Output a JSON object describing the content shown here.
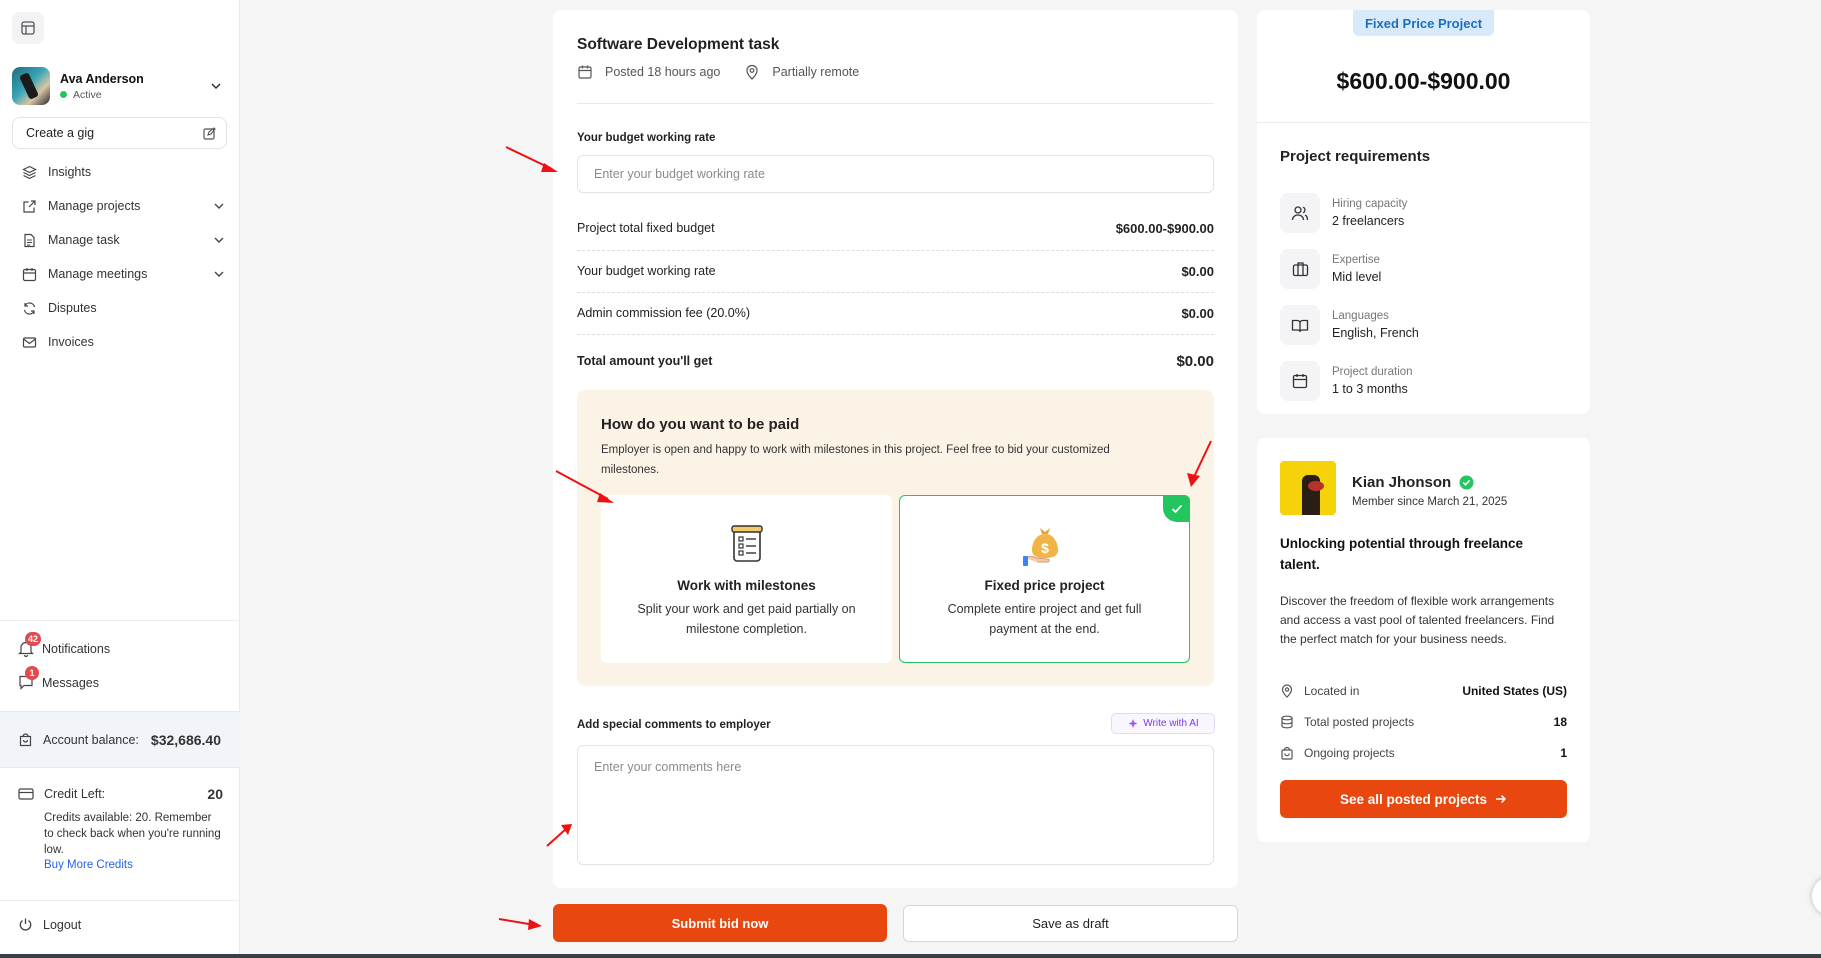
{
  "sidebar": {
    "user": {
      "name": "Ava Anderson",
      "status": "Active"
    },
    "create_gig": "Create a gig",
    "nav": [
      {
        "label": "Insights",
        "icon": "layers-icon"
      },
      {
        "label": "Manage projects",
        "icon": "external-link-icon"
      },
      {
        "label": "Manage task",
        "icon": "file-icon"
      },
      {
        "label": "Manage meetings",
        "icon": "calendar-icon"
      },
      {
        "label": "Disputes",
        "icon": "refresh-icon"
      },
      {
        "label": "Invoices",
        "icon": "mail-icon"
      }
    ],
    "notifications": {
      "label": "Notifications",
      "count": "42"
    },
    "messages": {
      "label": "Messages",
      "count": "1"
    },
    "balance": {
      "label": "Account balance:",
      "value": "$32,686.40"
    },
    "credits": {
      "label": "Credit Left:",
      "value": "20",
      "desc": "Credits available: 20. Remember to check back when you're running low.",
      "link": "Buy More Credits"
    },
    "logout": "Logout"
  },
  "task": {
    "title": "Software Development task",
    "posted": "Posted 18 hours ago",
    "location": "Partially remote"
  },
  "budget": {
    "label": "Your budget working rate",
    "placeholder": "Enter your budget working rate"
  },
  "costs": [
    {
      "label": "Project total fixed budget",
      "amount": "$600.00-$900.00"
    },
    {
      "label": "Your budget working rate",
      "amount": "$0.00"
    },
    {
      "label": "Admin commission fee (20.0%)",
      "amount": "$0.00"
    }
  ],
  "total": {
    "label": "Total amount you'll get",
    "amount": "$0.00"
  },
  "payment": {
    "title": "How do you want to be paid",
    "desc": "Employer is open and happy to work with milestones in this project. Feel free to bid your customized milestones.",
    "options": [
      {
        "title": "Work with milestones",
        "desc": "Split your work and get paid partially on milestone completion.",
        "selected": false
      },
      {
        "title": "Fixed price project",
        "desc": "Complete entire project and get full payment at the end.",
        "selected": true
      }
    ]
  },
  "comments": {
    "label": "Add special comments to employer",
    "ai_button": "Write with AI",
    "placeholder": "Enter your comments here"
  },
  "actions": {
    "submit": "Submit bid now",
    "draft": "Save as draft"
  },
  "project": {
    "tag": "Fixed Price Project",
    "price": "$600.00-$900.00",
    "requirements_title": "Project requirements",
    "requirements": [
      {
        "label": "Hiring capacity",
        "value": "2 freelancers",
        "icon": "users-icon"
      },
      {
        "label": "Expertise",
        "value": "Mid level",
        "icon": "briefcase-icon"
      },
      {
        "label": "Languages",
        "value": "English, French",
        "icon": "book-icon"
      },
      {
        "label": "Project duration",
        "value": "1 to 3 months",
        "icon": "calendar-icon"
      }
    ]
  },
  "employer": {
    "name": "Kian Jhonson",
    "since": "Member since March 21, 2025",
    "headline": "Unlocking potential through freelance talent.",
    "description": "Discover the freedom of flexible work arrangements and access a vast pool of talented freelancers. Find the perfect match for your business needs.",
    "stats": [
      {
        "label": "Located in",
        "value": "United States (US)",
        "icon": "map-pin-icon"
      },
      {
        "label": "Total posted projects",
        "value": "18",
        "icon": "database-icon"
      },
      {
        "label": "Ongoing projects",
        "value": "1",
        "icon": "bag-icon"
      }
    ],
    "cta": "See all posted projects"
  },
  "colors": {
    "accent": "#e8470f",
    "success": "#22c55e",
    "tag_bg": "#d7eafb",
    "pay_bg": "#fbf3e6"
  }
}
